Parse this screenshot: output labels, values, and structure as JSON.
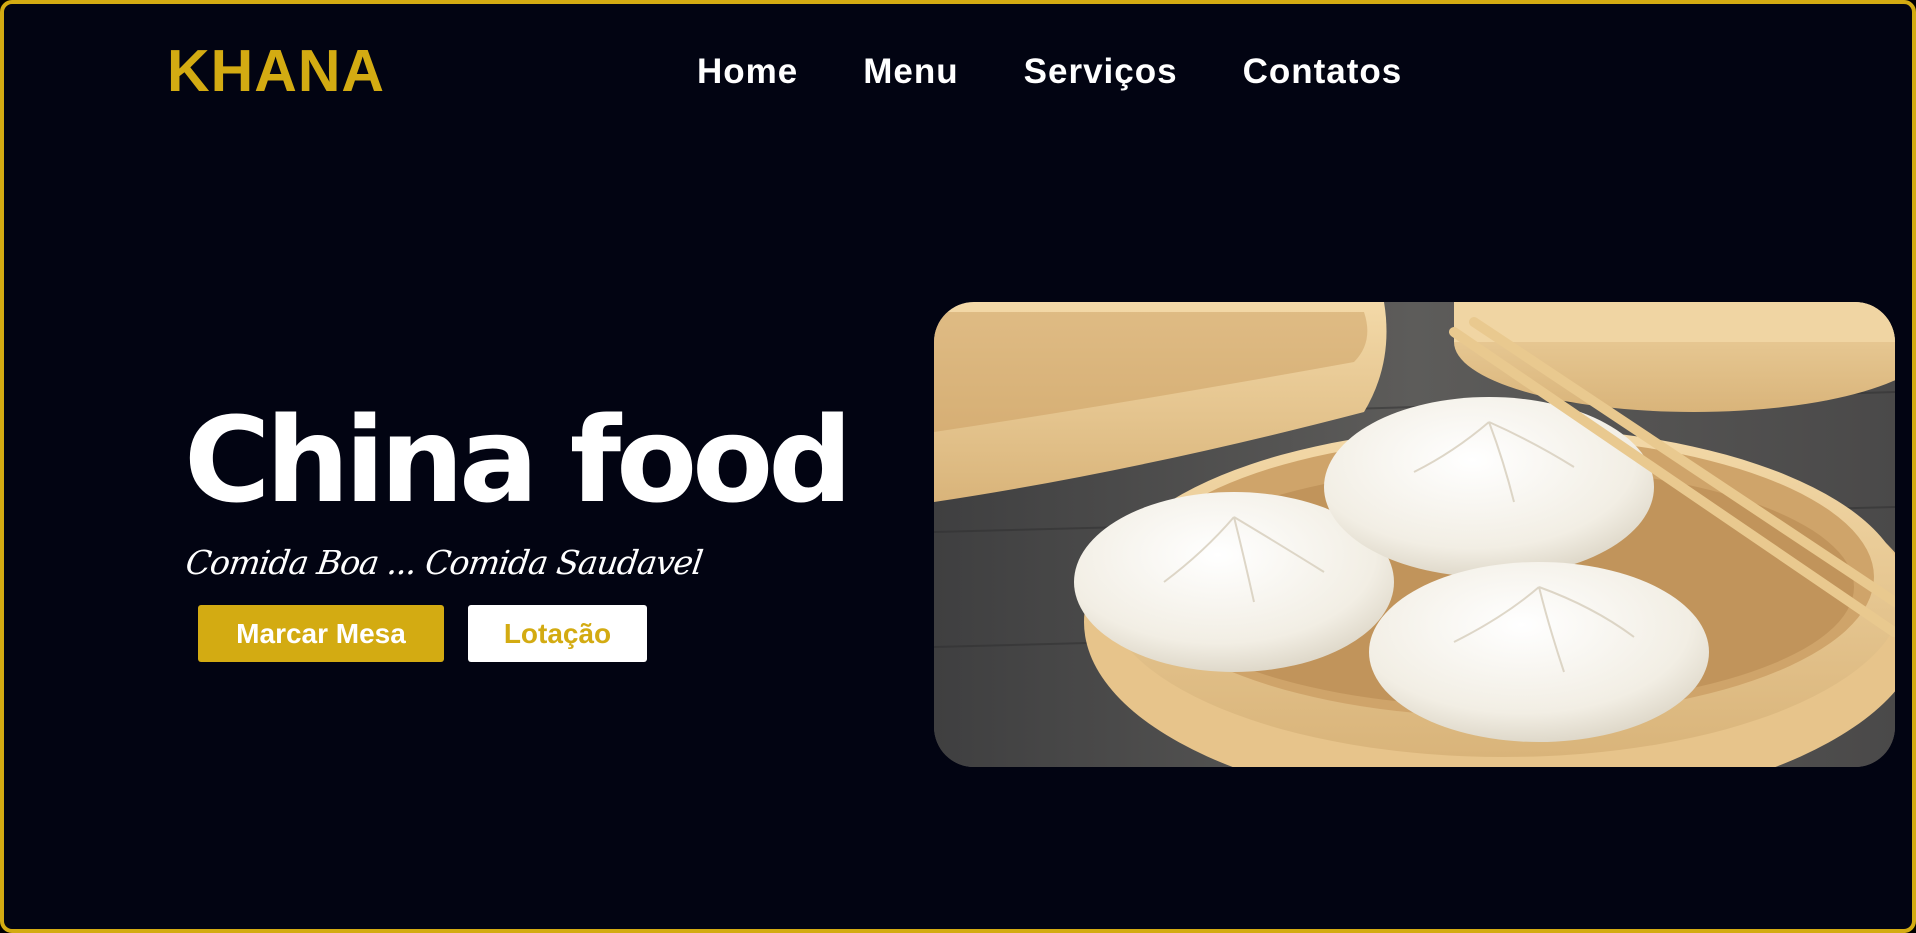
{
  "brand": {
    "logo": "KHANA",
    "accent_color": "#d3ab12",
    "background_color": "#020412"
  },
  "nav": {
    "items": [
      {
        "label": "Home"
      },
      {
        "label": "Menu"
      },
      {
        "label": "Serviços"
      },
      {
        "label": "Contatos"
      }
    ]
  },
  "hero": {
    "title": "China food",
    "subtitle": "Comida Boa ... Comida Saudavel",
    "primary_button": "Marcar Mesa",
    "secondary_button": "Lotação",
    "image": {
      "icon": "steamed-buns-in-bamboo-steamer-photo"
    }
  }
}
